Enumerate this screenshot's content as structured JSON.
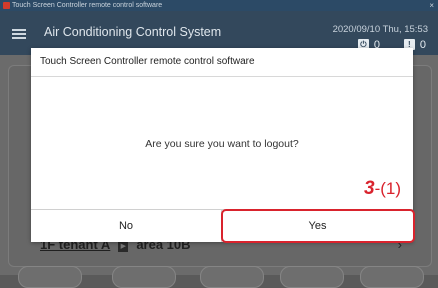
{
  "window": {
    "title": "Touch Screen Controller remote control software",
    "close_glyph": "×"
  },
  "header": {
    "title": "Air Conditioning Control System",
    "datetime": "2020/09/10 Thu, 15:53",
    "badges": [
      {
        "icon": "power-icon",
        "glyph": "⏻",
        "count": "0"
      },
      {
        "icon": "alert-icon",
        "glyph": "!",
        "count": "0"
      }
    ]
  },
  "background": {
    "tenant": "1F tenant A",
    "area": "area 10B",
    "chevron": "›"
  },
  "dialog": {
    "title": "Touch Screen Controller  remote control software",
    "message": "Are you sure you want to logout?",
    "no_label": "No",
    "yes_label": "Yes"
  },
  "annotation": {
    "step": "3",
    "sub": "-(1)",
    "color": "#d9232d"
  }
}
